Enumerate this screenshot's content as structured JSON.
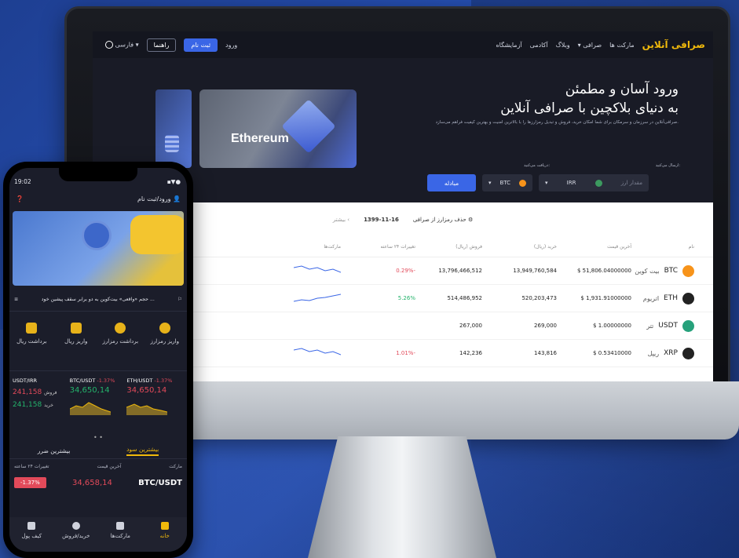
{
  "site": {
    "logo": "صرافی آنلاین",
    "nav": [
      "مارکت ها",
      "صرافی ▾",
      "وبلاگ",
      "آکادمی",
      "آزمایشگاه"
    ],
    "login": "ورود",
    "signup": "ثبت نام",
    "guide": "راهنما",
    "language": "فارسی ▾"
  },
  "hero": {
    "title_line1": "ورود آسان و مطمئن",
    "title_line2": "به دنیای بلاکچین با صرافی آنلاین",
    "desc": "صرافی‌آنلاین در سرزمان و سرمکان برای شما امکان خرید، فروش و تبدیل رمزارزها را با بالاترین امنیت و بهترین کیفیت فراهم می‌سازد.",
    "banner_text": "Ethereum"
  },
  "exchange": {
    "send_label": "ارسال می‌کنید:",
    "receive_label": "دریافت می‌کنید:",
    "amount_placeholder": "مقدار ارز",
    "from_currency": "IRR",
    "to_currency": "BTC",
    "submit": "مبادله"
  },
  "market": {
    "remove_text": "حذف رمزارز از صرافی",
    "date": "1399-11-16",
    "more": "بیشتر ‹",
    "headers": [
      "نام",
      "آخرین قیمت",
      "خرید (ریال)",
      "فروش (ریال)",
      "تغییرات ۲۴ ساعته",
      "مارکت‌ها"
    ],
    "rows": [
      {
        "sym": "BTC",
        "fa": "بیت کوین",
        "last": "51,806.04000000 $",
        "buy": "13,949,760,584",
        "sell": "13,796,466,512",
        "change": "-0.29%",
        "color": "#f7931a",
        "trend": "neg"
      },
      {
        "sym": "ETH",
        "fa": "اتریوم",
        "last": "1,931.91000000 $",
        "buy": "520,203,473",
        "sell": "514,486,952",
        "change": "5.26%",
        "color": "#222222",
        "trend": "pos"
      },
      {
        "sym": "USDT",
        "fa": "تتر",
        "last": "1.00000000 $",
        "buy": "269,000",
        "sell": "267,000",
        "change": "",
        "color": "#26a17b",
        "trend": "none"
      },
      {
        "sym": "XRP",
        "fa": "ریپل",
        "last": "0.53410000 $",
        "buy": "143,816",
        "sell": "142,236",
        "change": "-1.01%",
        "color": "#222222",
        "trend": "neg"
      }
    ]
  },
  "phone": {
    "time": "19:02",
    "status_icons": "▪▼●",
    "login": "ورود/ثبت نام",
    "ticker": "حجم «واقعی» بیت‌کوین به دو برابر سقف پیشین خود ...",
    "actions": [
      "واریز رمزارز",
      "برداشت رمزارز",
      "واریز ریال",
      "برداشت ریال"
    ],
    "pairs": [
      {
        "name": "ETH/USDT",
        "change": "-1.37%",
        "price": "34,650,14"
      },
      {
        "name": "BTC/USDT",
        "change": "-1.37%",
        "price": "34,650,14"
      },
      {
        "name": "USDT/IRR",
        "sell_label": "فروش",
        "sell": "241,158",
        "buy_label": "خرید",
        "buy": "241,158"
      }
    ],
    "dots": "• • ◆ •",
    "dots2": "• •",
    "tabs": [
      "بیشترین سود",
      "بیشترین ضرر"
    ],
    "colheads": [
      "مارکت",
      "آخرین قیمت",
      "تغییرات ۲۴ ساعته"
    ],
    "row": {
      "pair": "BTC/USDT",
      "price": "34,658,14",
      "change": "-1.37%"
    },
    "tabbar": [
      "خانه",
      "مارکت‌ها",
      "خرید/فروش",
      "کیف پول"
    ]
  },
  "colors": {
    "accent": "#f0b90b",
    "blue": "#3a66e6",
    "negative": "#e24a5a",
    "positive": "#24b36b"
  }
}
